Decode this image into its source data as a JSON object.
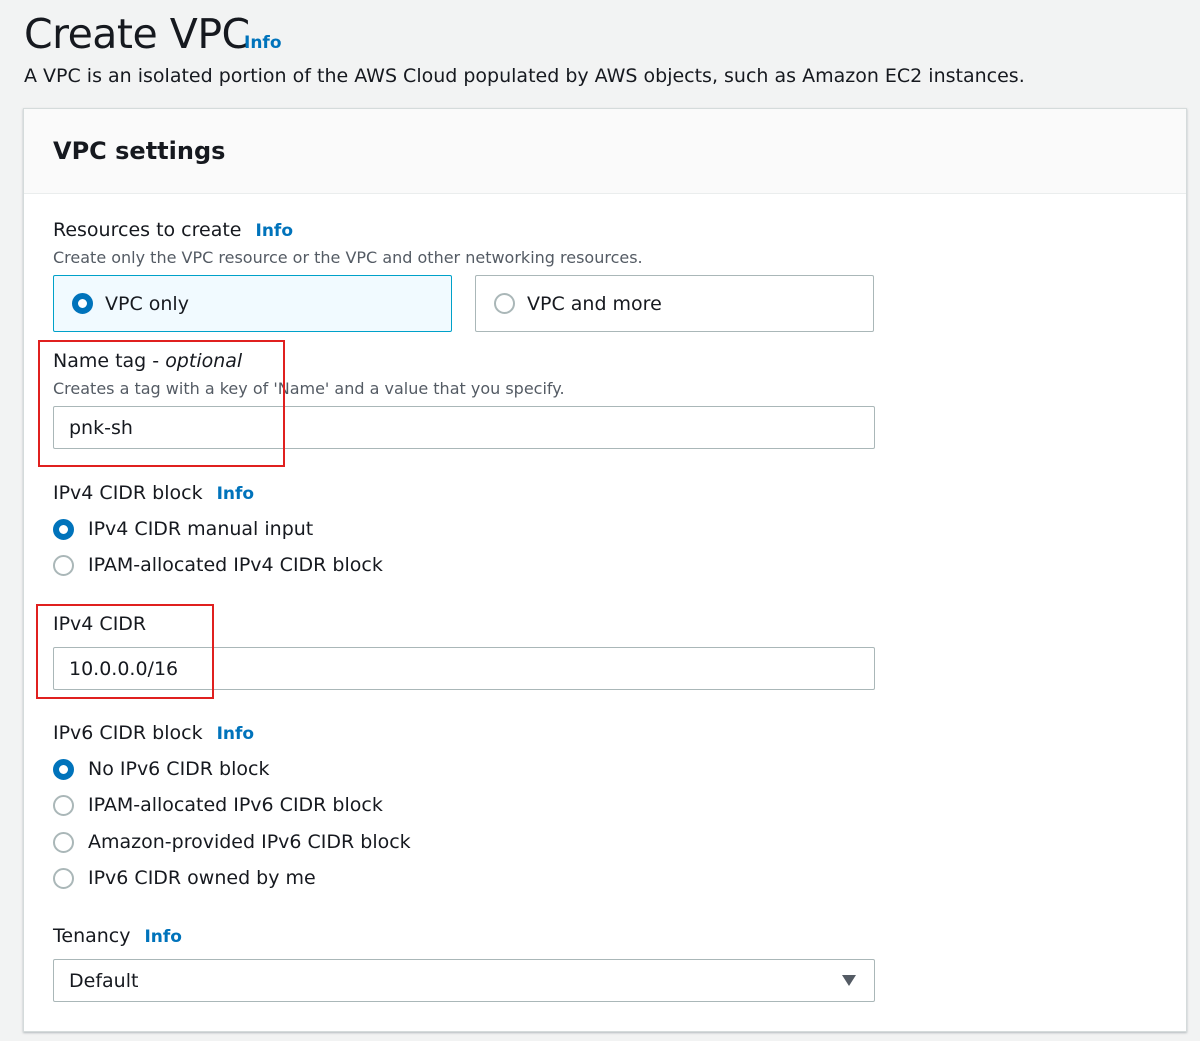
{
  "header": {
    "title": "Create VPC",
    "info": "Info",
    "description": "A VPC is an isolated portion of the AWS Cloud populated by AWS objects, such as Amazon EC2 instances."
  },
  "panel": {
    "title": "VPC settings"
  },
  "resources": {
    "label": "Resources to create",
    "info": "Info",
    "description": "Create only the VPC resource or the VPC and other networking resources.",
    "options": [
      {
        "label": "VPC only",
        "selected": true
      },
      {
        "label": "VPC and more",
        "selected": false
      }
    ]
  },
  "name_tag": {
    "label": "Name tag - ",
    "label_optional": "optional",
    "description": "Creates a tag with a key of 'Name' and a value that you specify.",
    "value": "pnk-sh"
  },
  "ipv4_block": {
    "label": "IPv4 CIDR block",
    "info": "Info",
    "options": [
      {
        "label": "IPv4 CIDR manual input",
        "selected": true
      },
      {
        "label": "IPAM-allocated IPv4 CIDR block",
        "selected": false
      }
    ]
  },
  "ipv4_cidr": {
    "label": "IPv4 CIDR",
    "value": "10.0.0.0/16"
  },
  "ipv6_block": {
    "label": "IPv6 CIDR block",
    "info": "Info",
    "options": [
      {
        "label": "No IPv6 CIDR block",
        "selected": true
      },
      {
        "label": "IPAM-allocated IPv6 CIDR block",
        "selected": false
      },
      {
        "label": "Amazon-provided IPv6 CIDR block",
        "selected": false
      },
      {
        "label": "IPv6 CIDR owned by me",
        "selected": false
      }
    ]
  },
  "tenancy": {
    "label": "Tenancy",
    "info": "Info",
    "value": "Default"
  },
  "colors": {
    "accent": "#0073bb",
    "highlight": "#e0201f",
    "selected_tile_bg": "#f1faff",
    "selected_tile_border": "#00a1c9"
  }
}
